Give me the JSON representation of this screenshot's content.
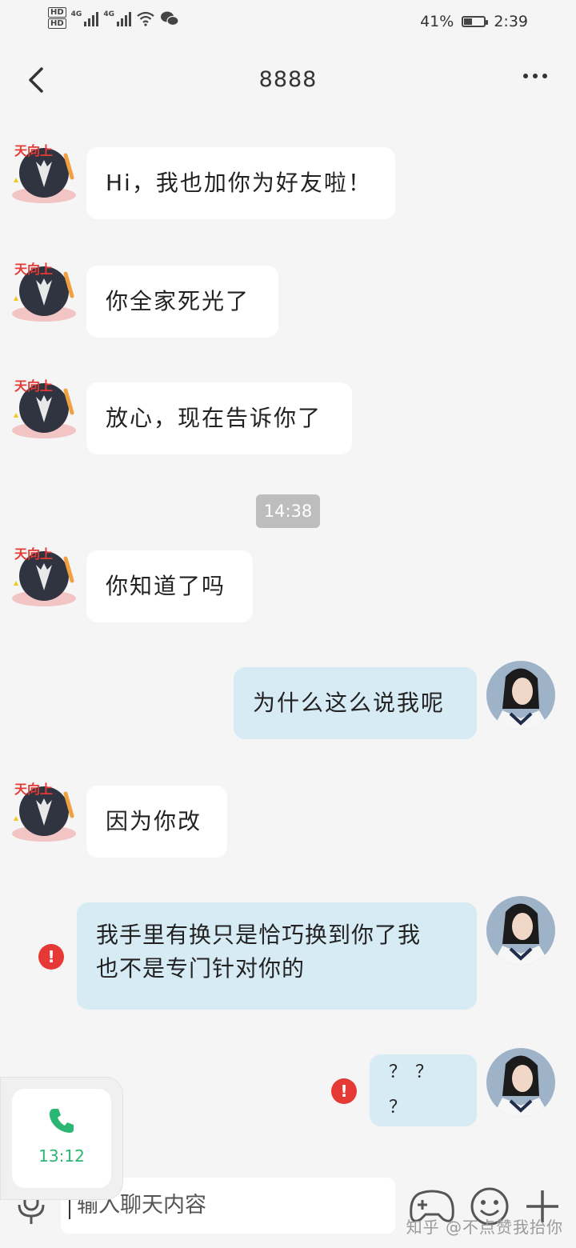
{
  "status_bar": {
    "battery_text": "41%",
    "battery_level": 0.41,
    "time": "2:39",
    "network_1": "4G",
    "network_2": "4G",
    "sim_1": "HD",
    "sim_2": "HD"
  },
  "header": {
    "title": "8888"
  },
  "messages": [
    {
      "side": "left",
      "text": "Hi，我也加你为好友啦！"
    },
    {
      "side": "left",
      "text": "你全家死光了"
    },
    {
      "side": "left",
      "text": "放心，现在告诉你了"
    },
    {
      "type": "time",
      "text": "14:38"
    },
    {
      "side": "left",
      "text": "你知道了吗"
    },
    {
      "side": "right",
      "text": "为什么这么说我呢"
    },
    {
      "side": "left",
      "text": "因为你改"
    },
    {
      "side": "right",
      "text": "我手里有换只是恰巧换到你了我也不是专门针对你的",
      "failed": true,
      "line1": "我手里有换只是恰巧换到你了我",
      "line2": "也不是专门针对你的"
    },
    {
      "side": "right",
      "text": "？ ？ ？",
      "failed": true
    }
  ],
  "call_card": {
    "duration": "13:12"
  },
  "input": {
    "placeholder": "输入聊天内容"
  },
  "watermark": "知乎 @不点赞我抬你",
  "colors": {
    "background": "#f5f5f5",
    "incoming_bubble": "#ffffff",
    "outgoing_bubble": "#d7ebf5",
    "error_badge": "#e53935",
    "call_green": "#2bb673"
  },
  "icons": [
    "back-arrow-icon",
    "more-icon",
    "error-icon",
    "phone-icon",
    "microphone-icon",
    "game-icon",
    "emoji-icon",
    "plus-icon"
  ]
}
